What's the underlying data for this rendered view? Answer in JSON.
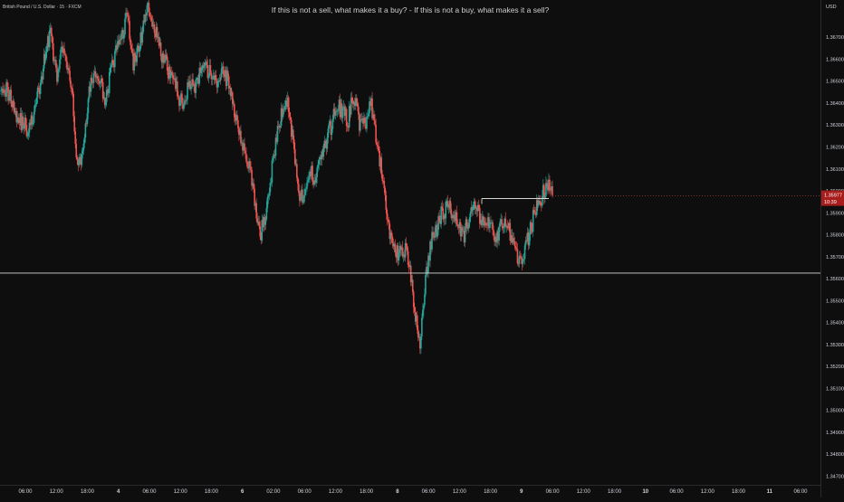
{
  "header": {
    "symbol": "British Pound / U.S. Dollar · 15 · FXCM",
    "title": "If this is not a sell, what makes it a buy? - If this is not a buy, what makes it a sell?"
  },
  "price_axis": {
    "currency": "USD",
    "current_price": "1.35977",
    "countdown": "10:39",
    "top_label": "1.36800"
  },
  "colors": {
    "background": "#0e0e0e",
    "up": "#26a69a",
    "down": "#ef5350",
    "wick": "#9a9a9a",
    "level_line": "#d8d8d8",
    "badge": "#a81c1c"
  },
  "chart_data": {
    "type": "candlestick",
    "ylim": [
      1.3466,
      1.3687
    ],
    "y_ticks": [
      "1.36700",
      "1.36600",
      "1.36500",
      "1.36400",
      "1.36300",
      "1.36200",
      "1.36100",
      "1.36000",
      "1.35900",
      "1.35800",
      "1.35700",
      "1.35600",
      "1.35500",
      "1.35400",
      "1.35300",
      "1.35200",
      "1.35100",
      "1.35000",
      "1.34900",
      "1.34800",
      "1.34700"
    ],
    "x_ticks": [
      {
        "label": "06:00",
        "bold": false
      },
      {
        "label": "12:00",
        "bold": false
      },
      {
        "label": "18:00",
        "bold": false
      },
      {
        "label": "4",
        "bold": true
      },
      {
        "label": "06:00",
        "bold": false
      },
      {
        "label": "12:00",
        "bold": false
      },
      {
        "label": "18:00",
        "bold": false
      },
      {
        "label": "6",
        "bold": true
      },
      {
        "label": "02:00",
        "bold": false
      },
      {
        "label": "06:00",
        "bold": false
      },
      {
        "label": "12:00",
        "bold": false
      },
      {
        "label": "18:00",
        "bold": false
      },
      {
        "label": "8",
        "bold": true
      },
      {
        "label": "06:00",
        "bold": false
      },
      {
        "label": "12:00",
        "bold": false
      },
      {
        "label": "18:00",
        "bold": false
      },
      {
        "label": "9",
        "bold": true
      },
      {
        "label": "06:00",
        "bold": false
      },
      {
        "label": "12:00",
        "bold": false
      },
      {
        "label": "18:00",
        "bold": false
      },
      {
        "label": "10",
        "bold": true
      },
      {
        "label": "06:00",
        "bold": false
      },
      {
        "label": "12:00",
        "bold": false
      },
      {
        "label": "18:00",
        "bold": false
      },
      {
        "label": "11",
        "bold": true
      },
      {
        "label": "06:00",
        "bold": false
      }
    ],
    "price_path": [
      1.365,
      1.3646,
      1.3642,
      1.3633,
      1.3631,
      1.3627,
      1.3635,
      1.3647,
      1.3661,
      1.3674,
      1.3652,
      1.3663,
      1.3658,
      1.364,
      1.3609,
      1.3622,
      1.3644,
      1.3655,
      1.3648,
      1.3642,
      1.3655,
      1.3664,
      1.3672,
      1.368,
      1.3658,
      1.3665,
      1.3677,
      1.3684,
      1.3673,
      1.3662,
      1.3657,
      1.3652,
      1.3645,
      1.3638,
      1.365,
      1.3647,
      1.3652,
      1.3655,
      1.3654,
      1.3648,
      1.3655,
      1.3651,
      1.364,
      1.3631,
      1.362,
      1.3611,
      1.3595,
      1.3579,
      1.359,
      1.3607,
      1.3624,
      1.3637,
      1.364,
      1.3623,
      1.36,
      1.3595,
      1.3609,
      1.3606,
      1.3616,
      1.3622,
      1.3631,
      1.364,
      1.3635,
      1.3633,
      1.3644,
      1.3631,
      1.363,
      1.3641,
      1.3623,
      1.3609,
      1.3588,
      1.3576,
      1.3571,
      1.3575,
      1.3568,
      1.3544,
      1.3531,
      1.356,
      1.3576,
      1.3583,
      1.359,
      1.3593,
      1.3591,
      1.3585,
      1.358,
      1.3589,
      1.3592,
      1.3588,
      1.3585,
      1.3582,
      1.3579,
      1.3586,
      1.3583,
      1.3575,
      1.3568,
      1.3573,
      1.3582,
      1.3592,
      1.3597,
      1.3603,
      1.3598
    ],
    "level_lines": [
      {
        "type": "horizontal",
        "price": 1.35625
      },
      {
        "type": "segment",
        "price": 1.35965
      }
    ],
    "current_price": 1.35977
  }
}
